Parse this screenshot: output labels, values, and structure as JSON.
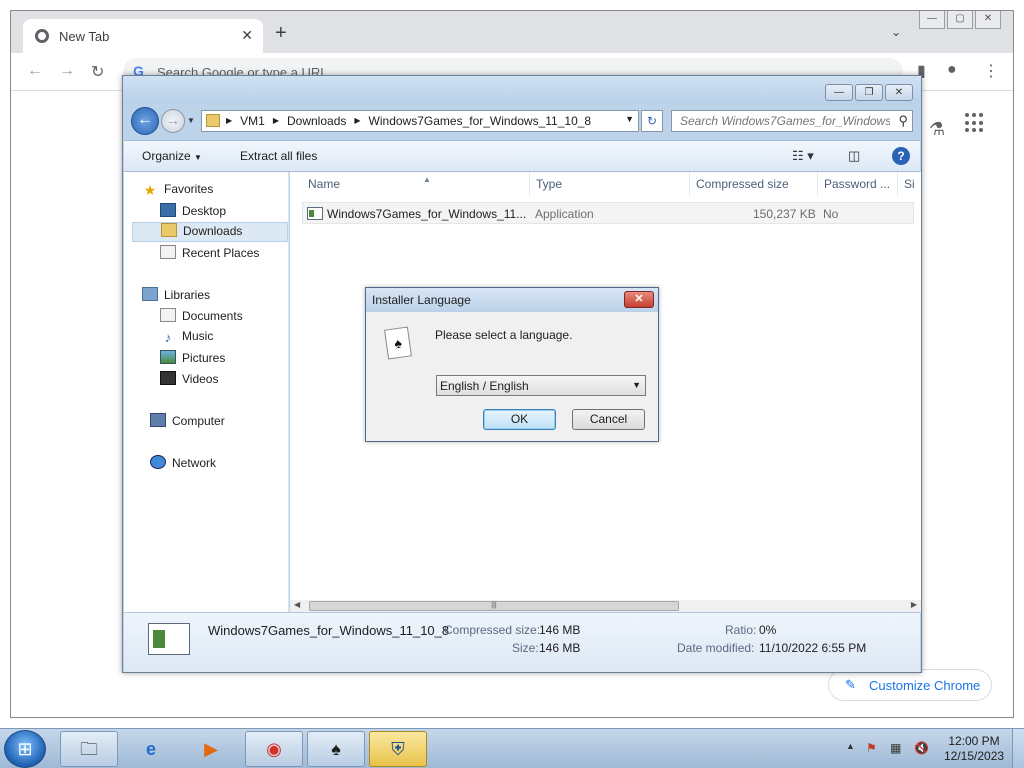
{
  "chrome": {
    "tab_title": "New Tab",
    "new_tab_symbol": "+",
    "close_symbol": "✕",
    "omnibox_placeholder": "Search Google or type a URL",
    "customize_label": "Customize Chrome"
  },
  "explorer": {
    "breadcrumbs": [
      "VM1",
      "Downloads",
      "Windows7Games_for_Windows_11_10_8"
    ],
    "search_placeholder": "Search Windows7Games_for_Windows...",
    "toolbar": {
      "organize": "Organize",
      "extract": "Extract all files"
    },
    "nav": {
      "favorites": "Favorites",
      "desktop": "Desktop",
      "downloads": "Downloads",
      "recent": "Recent Places",
      "libraries": "Libraries",
      "documents": "Documents",
      "music": "Music",
      "pictures": "Pictures",
      "videos": "Videos",
      "computer": "Computer",
      "network": "Network"
    },
    "columns": {
      "name": "Name",
      "type": "Type",
      "compressed": "Compressed size",
      "password": "Password ...",
      "size": "Si"
    },
    "file": {
      "name": "Windows7Games_for_Windows_11...",
      "type": "Application",
      "compressed": "150,237 KB",
      "password": "No"
    },
    "details": {
      "filename": "Windows7Games_for_Windows_11_10_8",
      "compressed_label": "Compressed size:",
      "compressed_value": "146 MB",
      "size_label": "Size:",
      "size_value": "146 MB",
      "ratio_label": "Ratio:",
      "ratio_value": "0%",
      "modified_label": "Date modified:",
      "modified_value": "11/10/2022 6:55 PM"
    }
  },
  "dialog": {
    "title": "Installer Language",
    "message": "Please select a language.",
    "selected_language": "English / English",
    "ok": "OK",
    "cancel": "Cancel"
  },
  "taskbar": {
    "time": "12:00 PM",
    "date": "12/15/2023"
  }
}
